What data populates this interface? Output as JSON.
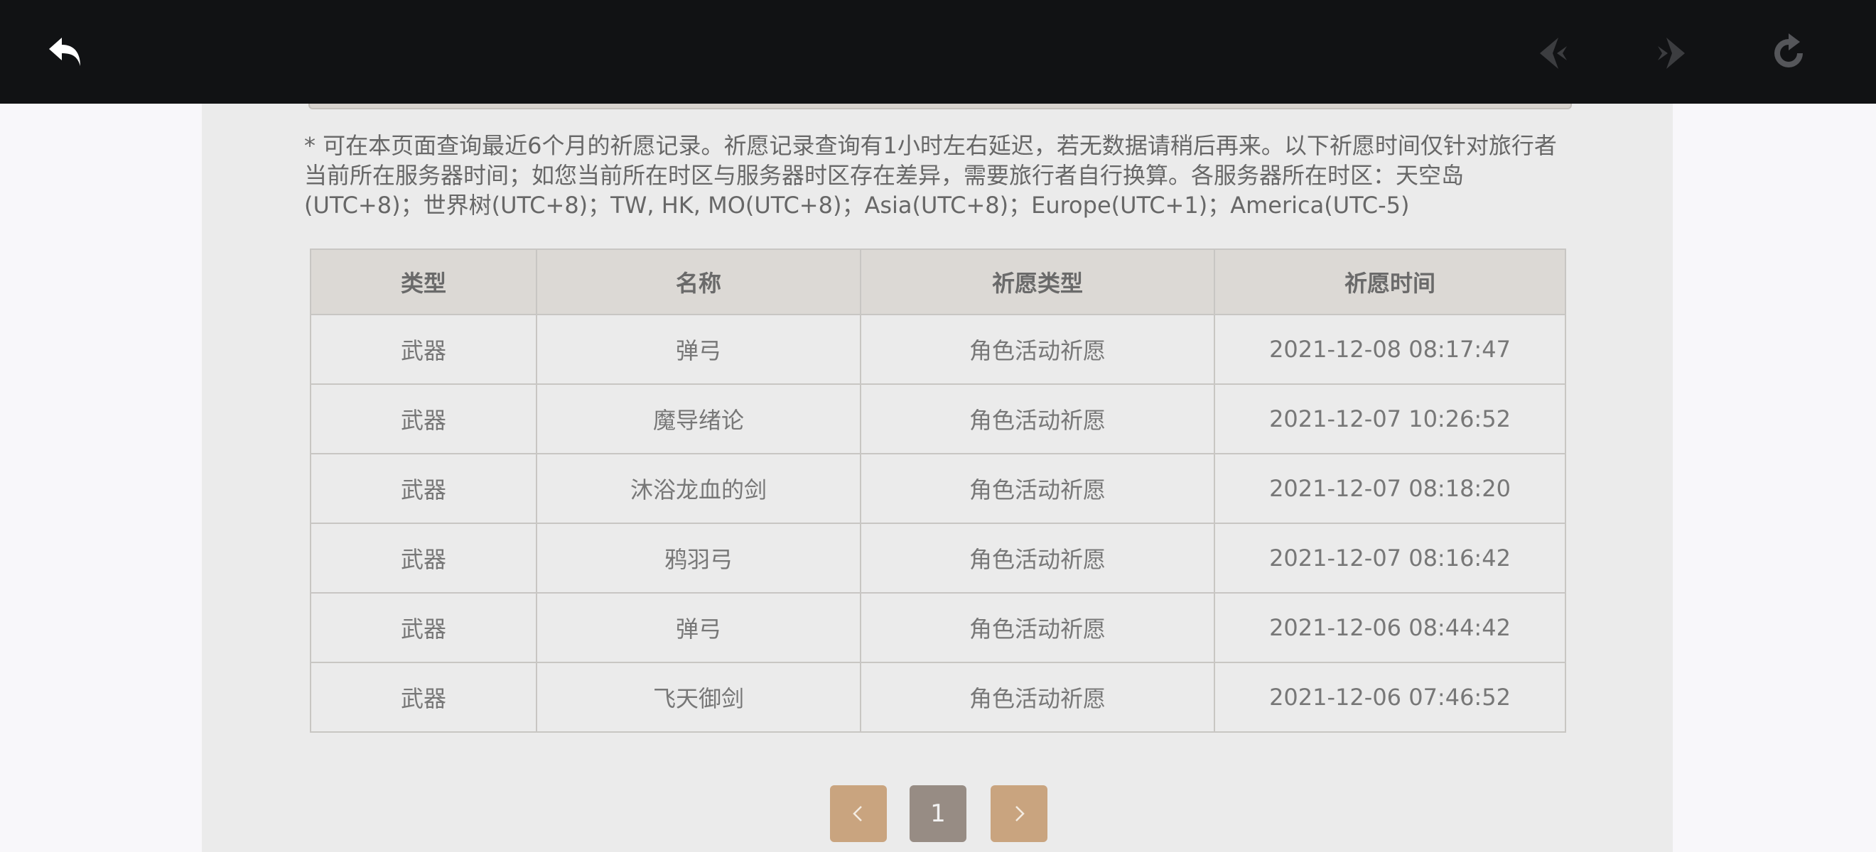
{
  "notice": "* 可在本页面查询最近6个月的祈愿记录。祈愿记录查询有1小时左右延迟，若无数据请稍后再来。以下祈愿时间仅针对旅行者当前所在服务器时间；如您当前所在时区与服务器时区存在差异，需要旅行者自行换算。各服务器所在时区：天空岛(UTC+8)；世界树(UTC+8)；TW, HK, MO(UTC+8)；Asia(UTC+8)；Europe(UTC+1)；America(UTC-5)",
  "table": {
    "headers": [
      "类型",
      "名称",
      "祈愿类型",
      "祈愿时间"
    ],
    "rows": [
      [
        "武器",
        "弹弓",
        "角色活动祈愿",
        "2021-12-08 08:17:47"
      ],
      [
        "武器",
        "魔导绪论",
        "角色活动祈愿",
        "2021-12-07 10:26:52"
      ],
      [
        "武器",
        "沐浴龙血的剑",
        "角色活动祈愿",
        "2021-12-07 08:18:20"
      ],
      [
        "武器",
        "鸦羽弓",
        "角色活动祈愿",
        "2021-12-07 08:16:42"
      ],
      [
        "武器",
        "弹弓",
        "角色活动祈愿",
        "2021-12-06 08:44:42"
      ],
      [
        "武器",
        "飞天御剑",
        "角色活动祈愿",
        "2021-12-06 07:46:52"
      ]
    ]
  },
  "pagination": {
    "current_page": "1",
    "prev_icon": "chevron-left-icon",
    "next_icon": "chevron-right-icon"
  },
  "toolbar": {
    "back_icon": "back-arrow-icon",
    "prev_icon": "nav-back-icon",
    "next_icon": "nav-forward-icon",
    "reload_icon": "reload-icon"
  },
  "colors": {
    "topbar": "#111214",
    "panel": "#ebebeb",
    "header_row": "#dcd9d5",
    "pager_arrow": "#c9a47f",
    "pager_current": "#978c84"
  }
}
